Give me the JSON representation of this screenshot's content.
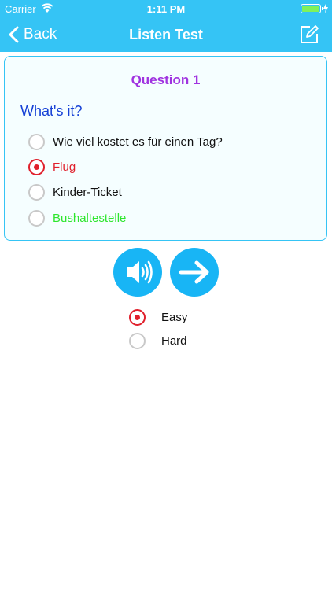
{
  "status_bar": {
    "carrier": "Carrier",
    "time": "1:11 PM",
    "battery_color": "#7ff25b"
  },
  "nav": {
    "back_label": "Back",
    "title": "Listen Test",
    "edit_icon": "compose-icon"
  },
  "question": {
    "title": "Question 1",
    "prompt": "What's it?",
    "options": [
      {
        "label": "Wie viel kostet es für einen Tag?",
        "selected": false,
        "color": "#111111"
      },
      {
        "label": "Flug",
        "selected": true,
        "color": "#e0202c"
      },
      {
        "label": "Kinder-Ticket",
        "selected": false,
        "color": "#111111"
      },
      {
        "label": "Bushaltestelle",
        "selected": false,
        "color": "#2ee62e"
      }
    ]
  },
  "controls": {
    "speaker_icon": "speaker-icon",
    "next_icon": "arrow-right-icon"
  },
  "level": {
    "options": [
      {
        "label": "Easy",
        "selected": true
      },
      {
        "label": "Hard",
        "selected": false
      }
    ]
  },
  "colors": {
    "accent": "#35c4f5",
    "button": "#18b5f5",
    "question_title": "#a033e0",
    "prompt": "#1641d6",
    "selected_radio": "#e0202c"
  }
}
